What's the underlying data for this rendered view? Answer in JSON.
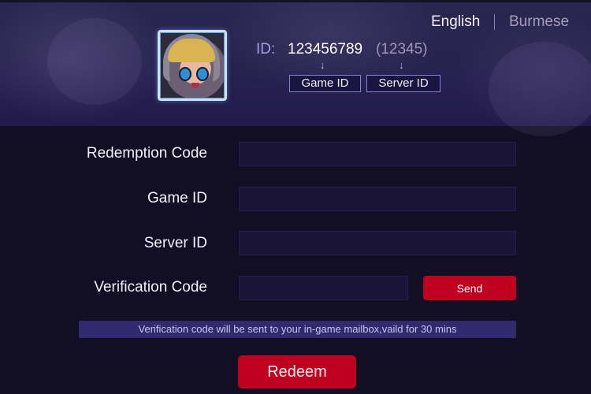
{
  "header": {
    "languages": [
      {
        "label": "English",
        "active": true
      },
      {
        "label": "Burmese",
        "active": false
      }
    ],
    "player": {
      "id_label": "ID:",
      "game_id": "123456789",
      "server_id": "(12345)",
      "arrow_icon": "↓",
      "game_id_tag": "Game ID",
      "server_id_tag": "Server ID"
    }
  },
  "form": {
    "fields": [
      {
        "label": "Redemption Code",
        "value": "",
        "placeholder": ""
      },
      {
        "label": "Game ID",
        "value": "",
        "placeholder": ""
      },
      {
        "label": "Server ID",
        "value": "",
        "placeholder": ""
      },
      {
        "label": "Verification Code",
        "value": "",
        "placeholder": ""
      }
    ],
    "send_label": "Send",
    "notice": "Verification code will be sent to your in-game mailbox,vaild for 30 mins",
    "redeem_label": "Redeem"
  },
  "colors": {
    "accent_red": "#c0001f",
    "header_bg": "#27214f",
    "page_bg": "#120f24",
    "notice_bg": "#322a6e"
  }
}
